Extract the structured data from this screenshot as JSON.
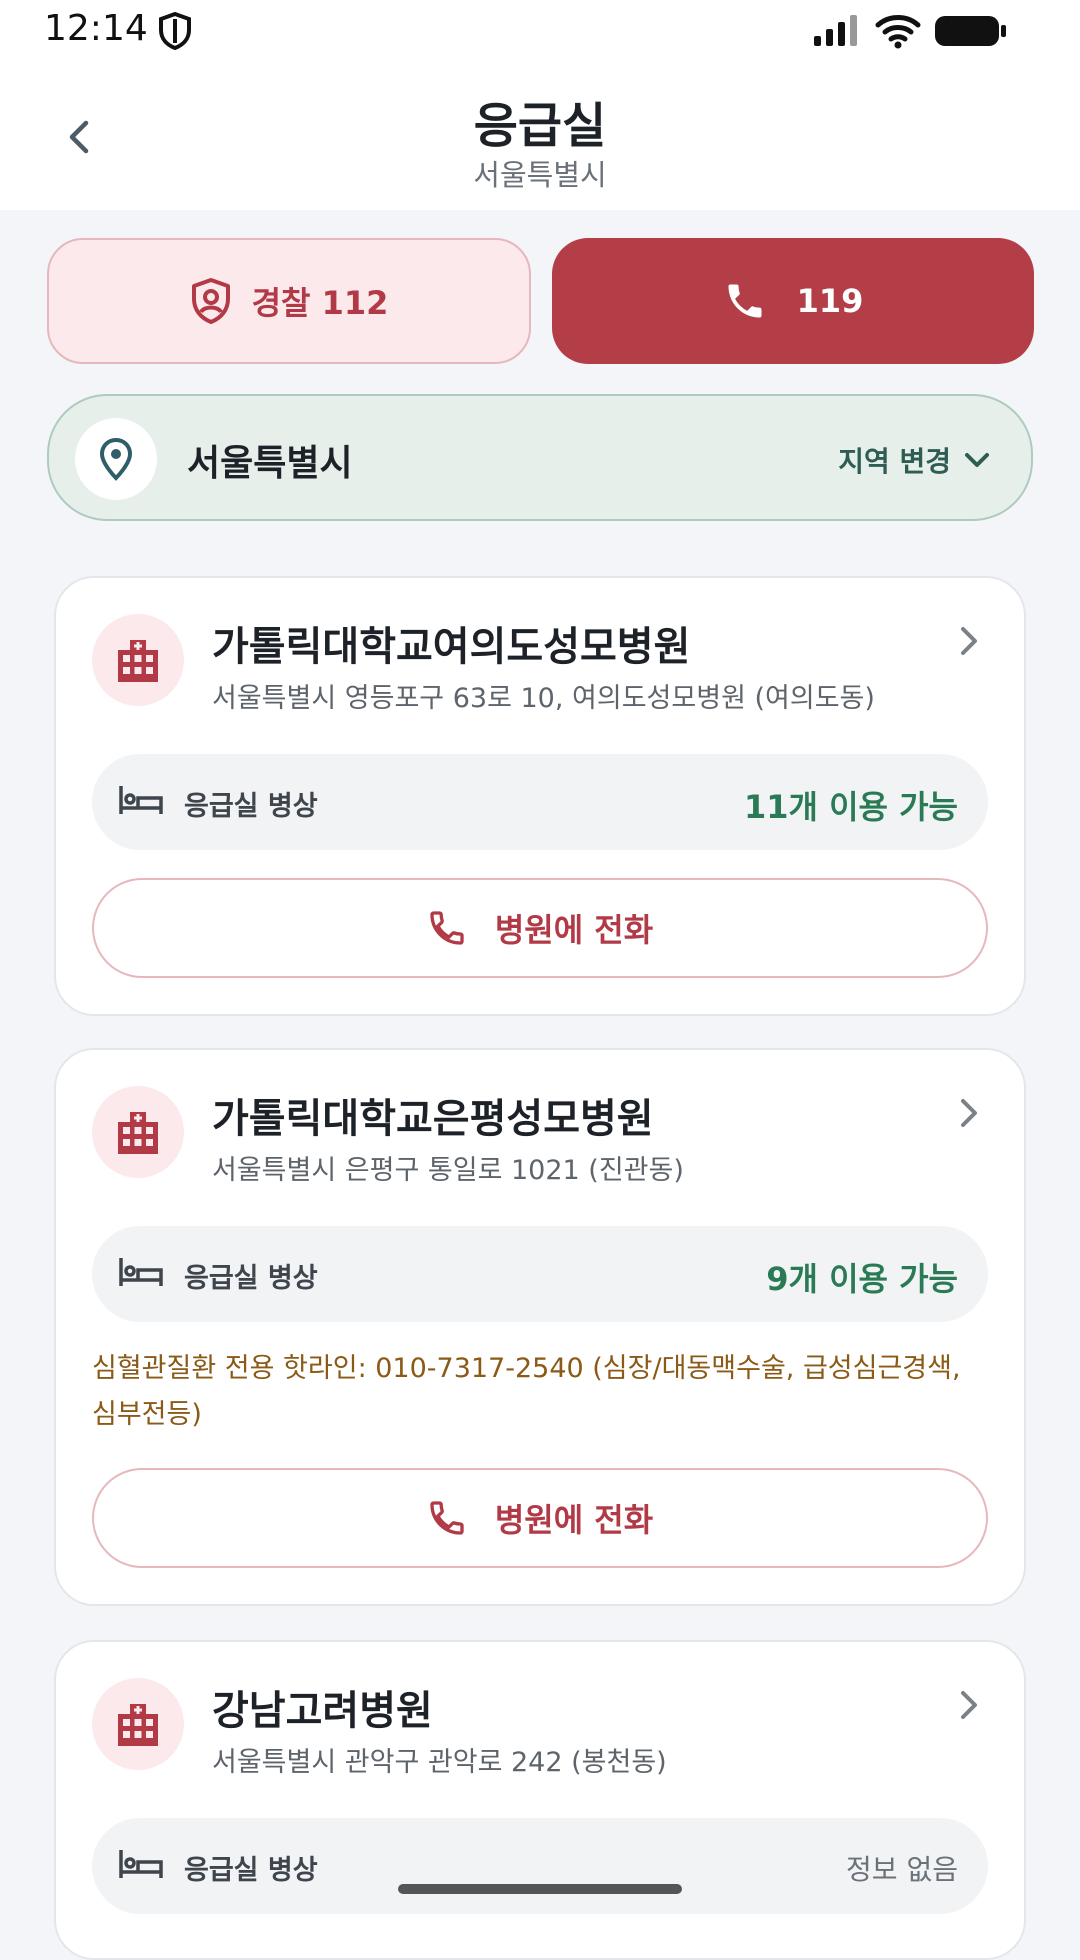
{
  "status_bar": {
    "time": "12:14"
  },
  "header": {
    "title": "응급실",
    "subtitle": "서울특별시"
  },
  "actions": {
    "police_label": "경찰 112",
    "emergency_label": "119"
  },
  "region": {
    "name": "서울특별시",
    "change_label": "지역 변경"
  },
  "hospitals": [
    {
      "name": "가톨릭대학교여의도성모병원",
      "address": "서울특별시 영등포구 63로 10, 여의도성모병원 (여의도동)",
      "bed_label": "응급실 병상",
      "bed_status": "11개 이용 가능",
      "call_label": "병원에 전화"
    },
    {
      "name": "가톨릭대학교은평성모병원",
      "address": "서울특별시 은평구 통일로 1021 (진관동)",
      "bed_label": "응급실 병상",
      "bed_status": "9개 이용 가능",
      "hotline": "심혈관질환 전용 핫라인: 010-7317-2540  (심장/대동맥수술, 급성심근경색, 심부전등)",
      "call_label": "병원에 전화"
    },
    {
      "name": "강남고려병원",
      "address": "서울특별시 관악구 관악로 242 (봉천동)",
      "bed_label": "응급실 병상",
      "bed_status": "정보 없음"
    }
  ],
  "colors": {
    "accent_red": "#b43e48",
    "available_green": "#2a7a55",
    "region_bg": "#e6efea",
    "hotline_brown": "#8a5a16"
  }
}
